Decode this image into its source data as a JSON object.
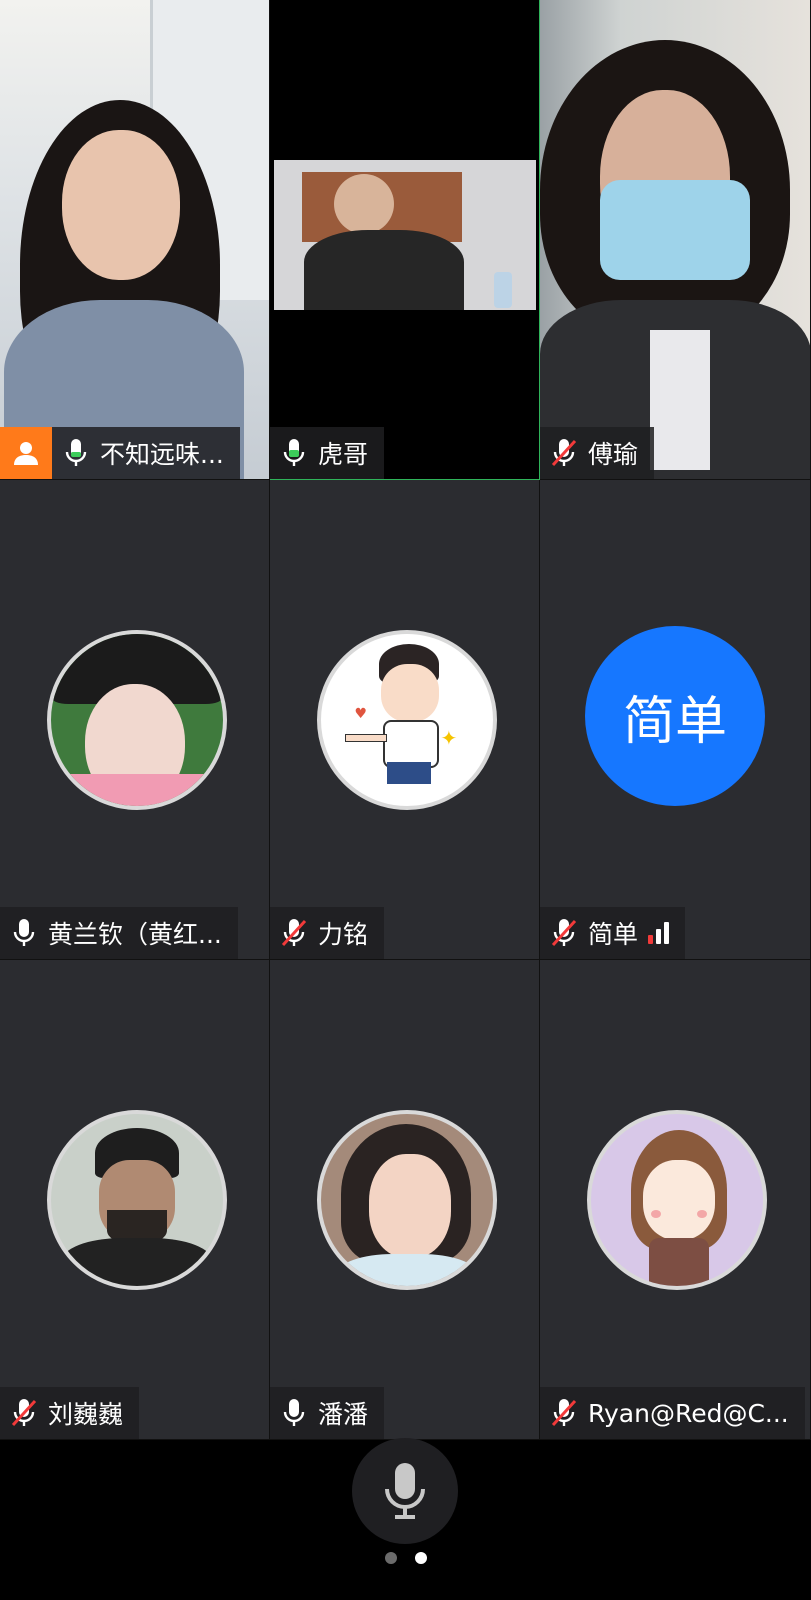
{
  "participants": [
    {
      "name": "不知远味...",
      "mic": "on",
      "host": true,
      "kind": "video",
      "scene": "a",
      "active": false
    },
    {
      "name": "虎哥",
      "mic": "on",
      "host": false,
      "kind": "video",
      "scene": "b",
      "active": true
    },
    {
      "name": "傅瑜",
      "mic": "muted",
      "host": false,
      "kind": "video",
      "scene": "c",
      "active": false
    },
    {
      "name": "黄兰钦（黄红...",
      "mic": "on",
      "host": false,
      "kind": "avatar",
      "avatar": "photo-woman-hat",
      "active": false
    },
    {
      "name": "力铭",
      "mic": "muted",
      "host": false,
      "kind": "avatar",
      "avatar": "cartoon-boy",
      "active": false
    },
    {
      "name": "简单",
      "mic": "muted",
      "host": false,
      "kind": "text-avatar",
      "avatar_text": "简单",
      "signal": true,
      "active": false
    },
    {
      "name": "刘巍巍",
      "mic": "muted",
      "host": false,
      "kind": "avatar",
      "avatar": "photo-man-beanie",
      "active": false
    },
    {
      "name": "潘潘",
      "mic": "on",
      "host": false,
      "kind": "avatar",
      "avatar": "photo-woman-bob",
      "active": false
    },
    {
      "name": "Ryan@Red@C...",
      "mic": "muted",
      "host": false,
      "kind": "avatar",
      "avatar": "cartoon-girl",
      "active": false
    }
  ],
  "controls": {
    "mic_button": "mic-icon"
  },
  "pagination": {
    "pages": 2,
    "current": 2
  },
  "colors": {
    "active_border": "#2fb45a",
    "host_badge": "#ff7a1a",
    "text_avatar": "#1677ff",
    "muted_slash": "#f23a3a"
  }
}
